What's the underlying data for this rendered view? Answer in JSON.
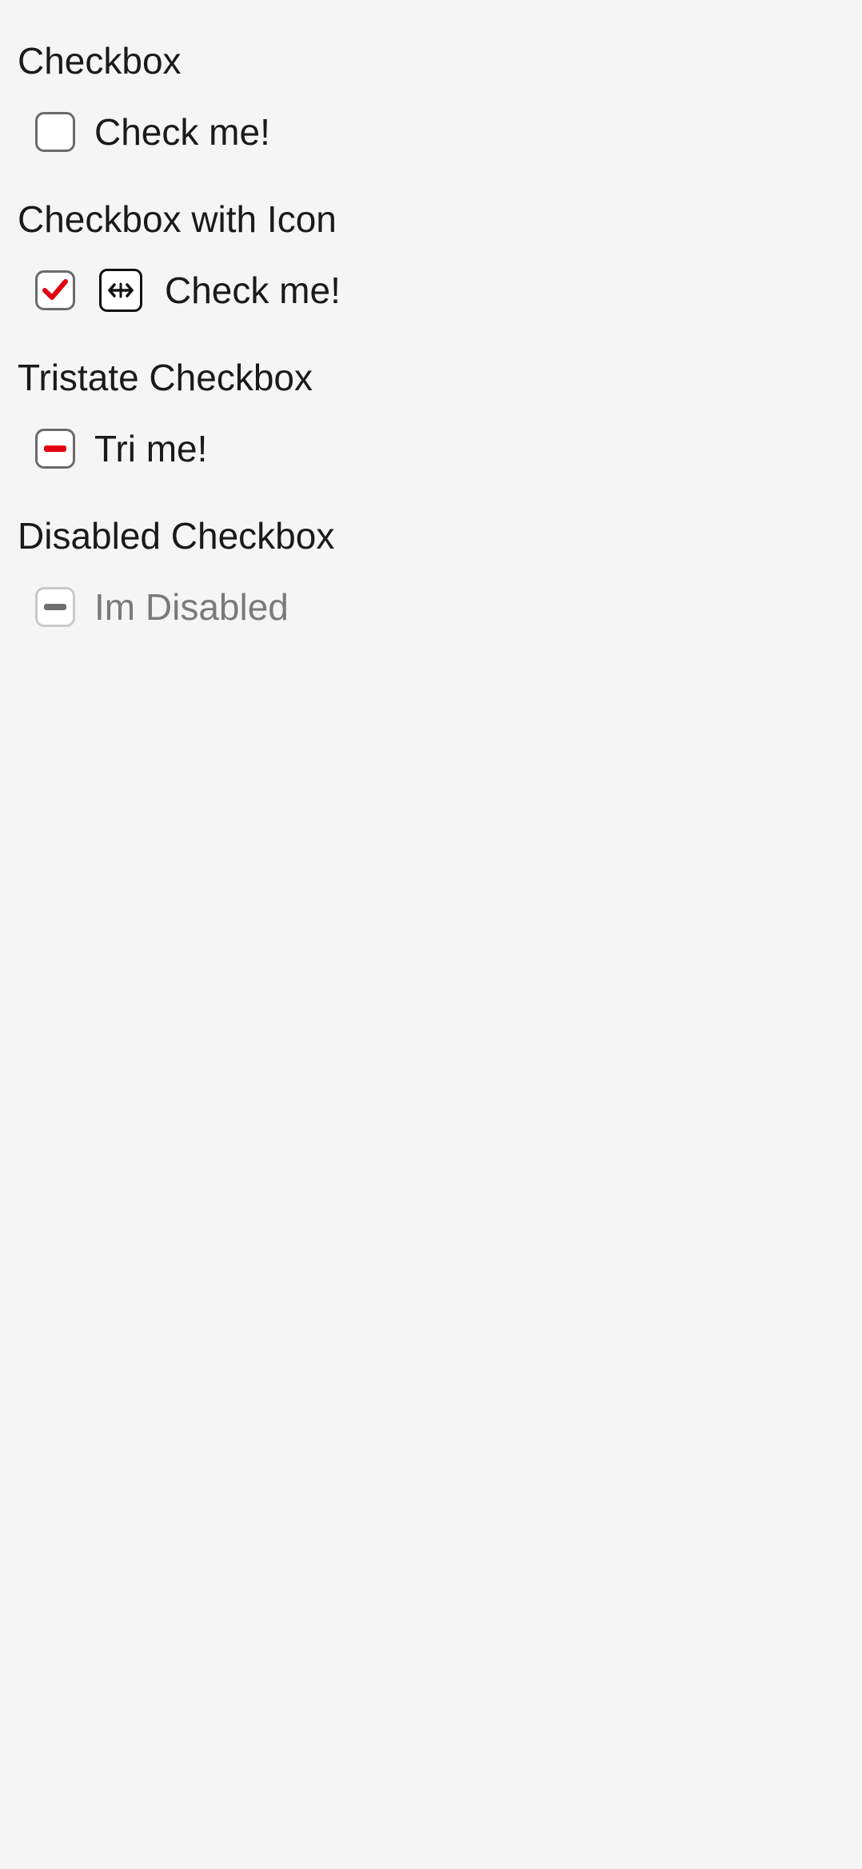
{
  "sections": {
    "checkbox": {
      "title": "Checkbox",
      "label": "Check me!",
      "checked": false
    },
    "checkbox_icon": {
      "title": "Checkbox with Icon",
      "label": "Check me!",
      "checked": true,
      "icon": "arrows-left-right-icon"
    },
    "tristate": {
      "title": "Tristate Checkbox",
      "label": "Tri me!",
      "state": "indeterminate"
    },
    "disabled": {
      "title": "Disabled Checkbox",
      "label": "Im Disabled",
      "state": "indeterminate",
      "disabled": true
    }
  },
  "colors": {
    "background": "#f5f5f5",
    "accent": "#e0000f",
    "text": "#1a1a1a",
    "disabled_text": "#7a7a7a",
    "disabled_mark": "#6e6e6e"
  }
}
